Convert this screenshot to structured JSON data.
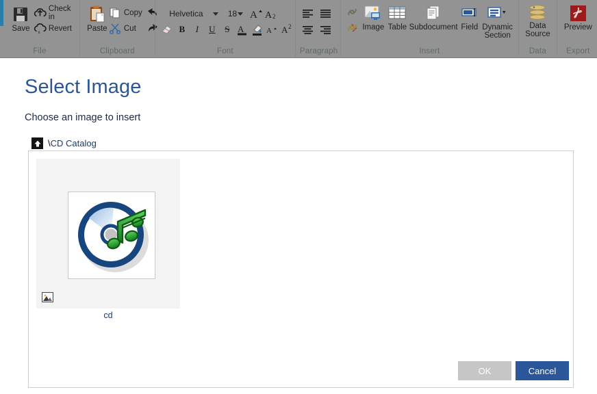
{
  "ribbon": {
    "groups": [
      {
        "label": "File",
        "buttons": [
          {
            "name": "save",
            "label": "Save",
            "icon": "floppy-disk-icon"
          },
          {
            "name": "check-in",
            "label": "Check in",
            "icon": "cloud-upload-icon"
          },
          {
            "name": "revert",
            "label": "Revert",
            "icon": "cloud-revert-icon"
          }
        ]
      },
      {
        "label": "Clipboard",
        "buttons": [
          {
            "name": "paste",
            "label": "Paste",
            "icon": "clipboard-icon"
          },
          {
            "name": "copy",
            "label": "Copy",
            "icon": "copy-pages-icon"
          },
          {
            "name": "cut",
            "label": "Cut",
            "icon": "scissors-icon"
          },
          {
            "name": "undo",
            "label": "",
            "icon": "undo-arrow-icon"
          },
          {
            "name": "redo",
            "label": "",
            "icon": "redo-arrow-icon"
          }
        ]
      },
      {
        "label": "Font",
        "font_name": "Helvetica",
        "font_size": "18",
        "buttons": [
          {
            "name": "clear-formatting",
            "label": "",
            "icon": "eraser-icon"
          },
          {
            "name": "grow-font",
            "label": "A",
            "icon": "grow-font-icon"
          },
          {
            "name": "shrink-font",
            "label": "A",
            "icon": "shrink-font-icon"
          },
          {
            "name": "bold",
            "label": "B",
            "icon": "bold-icon"
          },
          {
            "name": "italic",
            "label": "I",
            "icon": "italic-icon"
          },
          {
            "name": "underline",
            "label": "U",
            "icon": "underline-icon"
          },
          {
            "name": "strikethrough",
            "label": "S",
            "icon": "strikethrough-icon"
          },
          {
            "name": "font-color",
            "label": "A",
            "icon": "font-color-icon"
          },
          {
            "name": "highlight-color",
            "label": "",
            "icon": "paint-bucket-icon"
          },
          {
            "name": "subscript",
            "label": "A",
            "icon": "subscript-icon"
          },
          {
            "name": "superscript",
            "label": "A",
            "icon": "superscript-icon"
          }
        ]
      },
      {
        "label": "Paragraph",
        "buttons": [
          {
            "name": "align-left",
            "label": "",
            "icon": "align-left-icon"
          },
          {
            "name": "align-justify",
            "label": "",
            "icon": "align-justify-icon"
          },
          {
            "name": "align-center",
            "label": "",
            "icon": "align-center-icon"
          },
          {
            "name": "align-right",
            "label": "",
            "icon": "align-right-icon"
          }
        ]
      },
      {
        "label": "Insert",
        "buttons": [
          {
            "name": "insert-link",
            "label": "",
            "icon": "link-icon"
          },
          {
            "name": "remove-link",
            "label": "",
            "icon": "unlink-icon"
          },
          {
            "name": "insert-image",
            "label": "Image",
            "icon": "image-icon"
          },
          {
            "name": "insert-table",
            "label": "Table",
            "icon": "table-icon"
          },
          {
            "name": "insert-subdocument",
            "label": "Subdocument",
            "icon": "subdocument-icon"
          },
          {
            "name": "insert-field",
            "label": "Field",
            "icon": "field-icon"
          },
          {
            "name": "insert-dynamic-section",
            "label": "Dynamic\nSection",
            "icon": "dynamic-section-icon"
          }
        ]
      },
      {
        "label": "Data",
        "buttons": [
          {
            "name": "data-source",
            "label": "Data\nSource",
            "icon": "database-stack-icon"
          }
        ]
      },
      {
        "label": "Export",
        "buttons": [
          {
            "name": "preview",
            "label": "Preview",
            "icon": "pdf-icon"
          }
        ]
      }
    ]
  },
  "dialog": {
    "title": "Select Image",
    "subtitle": "Choose an image to insert",
    "breadcrumb": {
      "up_icon": "up-arrow-icon",
      "slash": "\\",
      "path": "CD Catalog"
    },
    "files": [
      {
        "name": "cd",
        "thumbnail_icon": "cd-music-icon",
        "badge_icon": "picture-icon"
      }
    ],
    "buttons": {
      "ok": "OK",
      "cancel": "Cancel"
    }
  },
  "colors": {
    "ribbon_background": "#939393",
    "ribbon_accent": "#2a7fa8",
    "title_blue": "#2b5797",
    "cancel_blue": "#2b579a",
    "ok_disabled_gray": "#c6c6c6",
    "cell_background": "#f3f3f3",
    "listbox_border": "#cfcfcf"
  }
}
